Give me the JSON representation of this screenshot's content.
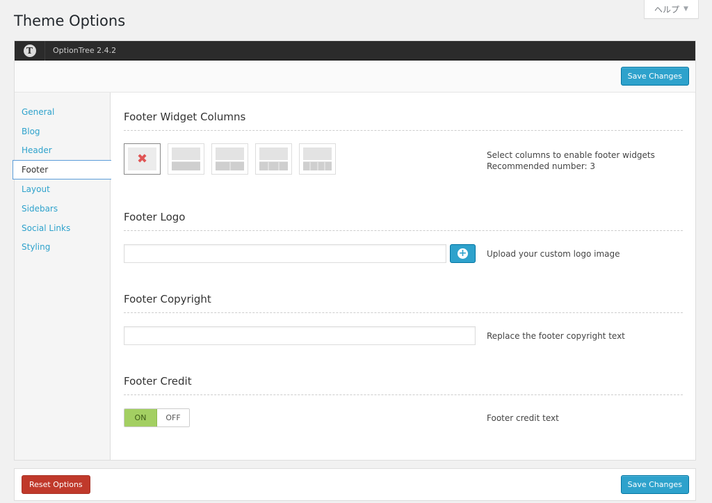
{
  "help_tab": {
    "label": "ヘルプ"
  },
  "page": {
    "title": "Theme Options"
  },
  "header": {
    "app_name": "OptionTree 2.4.2"
  },
  "actions": {
    "save_label": "Save Changes",
    "reset_label": "Reset Options"
  },
  "sidebar": {
    "items": [
      {
        "label": "General",
        "active": false
      },
      {
        "label": "Blog",
        "active": false
      },
      {
        "label": "Header",
        "active": false
      },
      {
        "label": "Footer",
        "active": true
      },
      {
        "label": "Layout",
        "active": false
      },
      {
        "label": "Sidebars",
        "active": false
      },
      {
        "label": "Social Links",
        "active": false
      },
      {
        "label": "Styling",
        "active": false
      }
    ]
  },
  "sections": {
    "widget_columns": {
      "title": "Footer Widget Columns",
      "description_line1": "Select columns to enable footer widgets",
      "description_line2": "Recommended number: 3",
      "selected_option": 0,
      "options": [
        0,
        1,
        2,
        3,
        4
      ]
    },
    "logo": {
      "title": "Footer Logo",
      "value": "",
      "description": "Upload your custom logo image"
    },
    "copyright": {
      "title": "Footer Copyright",
      "value": "",
      "description": "Replace the footer copyright text"
    },
    "credit": {
      "title": "Footer Credit",
      "on_label": "ON",
      "off_label": "OFF",
      "state": "on",
      "description": "Footer credit text"
    }
  },
  "colors": {
    "accent": "#2ea2cc",
    "toggle_on": "#a3cf62",
    "reset": "#c0392b",
    "header_bg": "#2b2b2b"
  }
}
